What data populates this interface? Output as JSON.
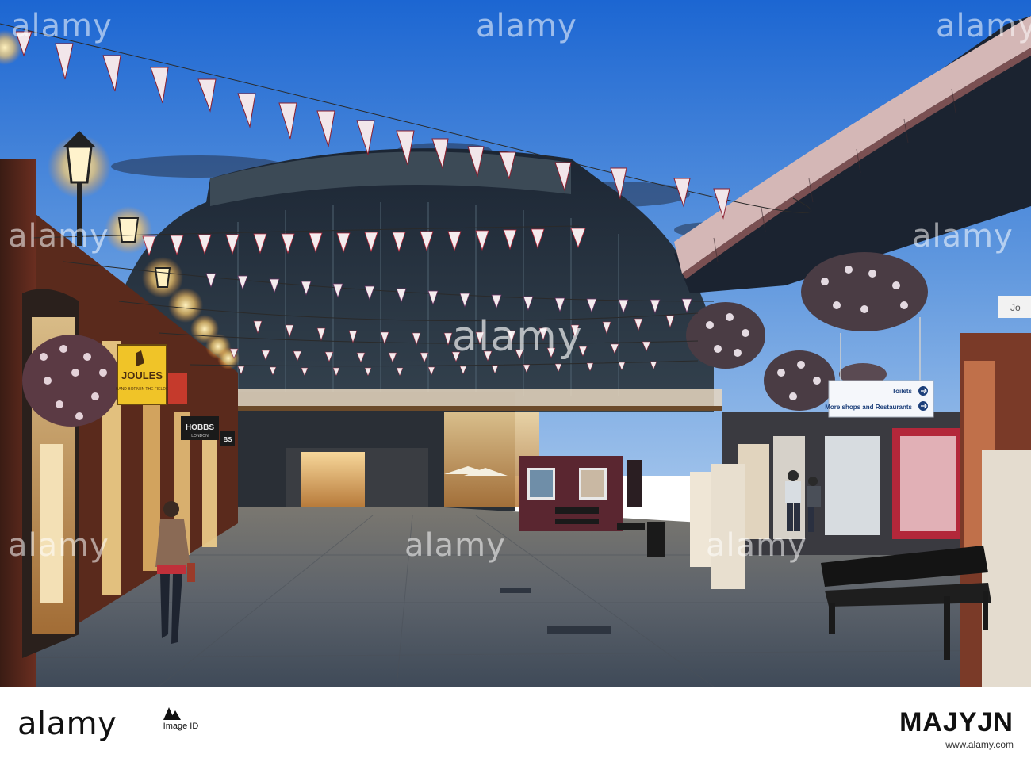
{
  "scene": {
    "signs": {
      "joules_brand": "JOULES",
      "joules_sub": "HAND BORN IN THE FIELDS",
      "hobbs_main": "HOBBS",
      "hobbs_sub": "LONDON",
      "hobbs_partial": "BS",
      "wayfinding": {
        "toilets": "Toilets",
        "more_shops": "More shops and Restaurants"
      },
      "partial_shop_sign": "Jo"
    }
  },
  "watermark": {
    "text": "alamy"
  },
  "footer": {
    "brand": "alamy",
    "image_id_label": "Image ID",
    "photo_id": "MAJYJN",
    "site": "www.alamy.com"
  },
  "colors": {
    "sky_top": "#1f6fd8",
    "sky_bottom": "#8fb6e6",
    "pavement": "#5c6470",
    "lamp_glow": "#ffd57a",
    "joules_sign": "#f0c428",
    "wayfinding_sign": "#f5f7fb"
  }
}
